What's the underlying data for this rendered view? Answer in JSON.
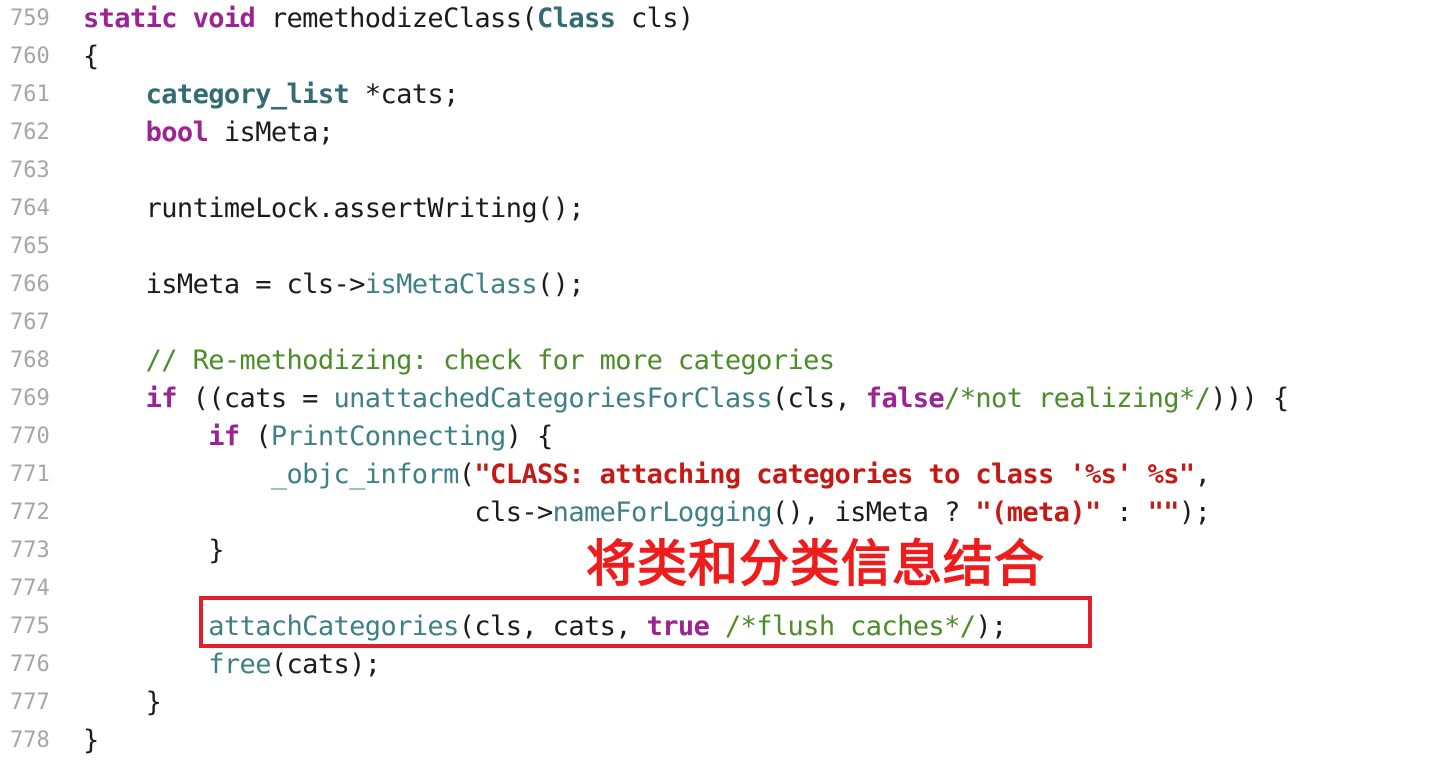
{
  "editor": {
    "lines": [
      {
        "num": "759",
        "tokens": [
          {
            "t": "static",
            "c": "kw"
          },
          {
            "t": " ",
            "c": "plain"
          },
          {
            "t": "void",
            "c": "kw"
          },
          {
            "t": " remethodizeClass(",
            "c": "plain"
          },
          {
            "t": "Class",
            "c": "type"
          },
          {
            "t": " cls)",
            "c": "plain"
          }
        ]
      },
      {
        "num": "760",
        "tokens": [
          {
            "t": "{",
            "c": "plain"
          }
        ]
      },
      {
        "num": "761",
        "tokens": [
          {
            "t": "    ",
            "c": "plain"
          },
          {
            "t": "category_list",
            "c": "type"
          },
          {
            "t": " *cats;",
            "c": "plain"
          }
        ]
      },
      {
        "num": "762",
        "tokens": [
          {
            "t": "    ",
            "c": "plain"
          },
          {
            "t": "bool",
            "c": "kw"
          },
          {
            "t": " isMeta;",
            "c": "plain"
          }
        ]
      },
      {
        "num": "763",
        "tokens": []
      },
      {
        "num": "764",
        "tokens": [
          {
            "t": "    runtimeLock.assertWriting();",
            "c": "plain"
          }
        ]
      },
      {
        "num": "765",
        "tokens": []
      },
      {
        "num": "766",
        "tokens": [
          {
            "t": "    isMeta = cls->",
            "c": "plain"
          },
          {
            "t": "isMetaClass",
            "c": "fn"
          },
          {
            "t": "();",
            "c": "plain"
          }
        ]
      },
      {
        "num": "767",
        "tokens": []
      },
      {
        "num": "768",
        "tokens": [
          {
            "t": "    ",
            "c": "plain"
          },
          {
            "t": "// Re-methodizing: check for more categories",
            "c": "cmt"
          }
        ]
      },
      {
        "num": "769",
        "tokens": [
          {
            "t": "    ",
            "c": "plain"
          },
          {
            "t": "if",
            "c": "kw"
          },
          {
            "t": " ((cats = ",
            "c": "plain"
          },
          {
            "t": "unattachedCategoriesForClass",
            "c": "fn"
          },
          {
            "t": "(cls, ",
            "c": "plain"
          },
          {
            "t": "false",
            "c": "kw"
          },
          {
            "t": "/*not realizing*/",
            "c": "cmt"
          },
          {
            "t": "))) {",
            "c": "plain"
          }
        ]
      },
      {
        "num": "770",
        "tokens": [
          {
            "t": "        ",
            "c": "plain"
          },
          {
            "t": "if",
            "c": "kw"
          },
          {
            "t": " (",
            "c": "plain"
          },
          {
            "t": "PrintConnecting",
            "c": "fn"
          },
          {
            "t": ") {",
            "c": "plain"
          }
        ]
      },
      {
        "num": "771",
        "tokens": [
          {
            "t": "            ",
            "c": "plain"
          },
          {
            "t": "_objc_inform",
            "c": "fn"
          },
          {
            "t": "(",
            "c": "plain"
          },
          {
            "t": "\"CLASS: attaching categories to class '%s' %s\"",
            "c": "str"
          },
          {
            "t": ",",
            "c": "plain"
          }
        ]
      },
      {
        "num": "772",
        "tokens": [
          {
            "t": "                         cls->",
            "c": "plain"
          },
          {
            "t": "nameForLogging",
            "c": "fn"
          },
          {
            "t": "(), isMeta ? ",
            "c": "plain"
          },
          {
            "t": "\"(meta)\"",
            "c": "str"
          },
          {
            "t": " : ",
            "c": "plain"
          },
          {
            "t": "\"\"",
            "c": "str"
          },
          {
            "t": ");",
            "c": "plain"
          }
        ]
      },
      {
        "num": "773",
        "tokens": [
          {
            "t": "        }",
            "c": "plain"
          }
        ]
      },
      {
        "num": "774",
        "tokens": []
      },
      {
        "num": "775",
        "tokens": [
          {
            "t": "        ",
            "c": "plain"
          },
          {
            "t": "attachCategories",
            "c": "fn"
          },
          {
            "t": "(cls, cats, ",
            "c": "plain"
          },
          {
            "t": "true",
            "c": "kw"
          },
          {
            "t": " ",
            "c": "plain"
          },
          {
            "t": "/*flush caches*/",
            "c": "cmt"
          },
          {
            "t": ");",
            "c": "plain"
          }
        ]
      },
      {
        "num": "776",
        "tokens": [
          {
            "t": "        ",
            "c": "plain"
          },
          {
            "t": "free",
            "c": "fn"
          },
          {
            "t": "(cats);",
            "c": "plain"
          }
        ]
      },
      {
        "num": "777",
        "tokens": [
          {
            "t": "    }",
            "c": "plain"
          }
        ]
      },
      {
        "num": "778",
        "tokens": [
          {
            "t": "}",
            "c": "plain"
          }
        ]
      }
    ]
  },
  "annotation": {
    "text": "将类和分类信息结合",
    "color": "#ee1c1c"
  },
  "highlight": {
    "line": "775",
    "border_color": "#e0202a"
  },
  "colors": {
    "keyword": "#9b2393",
    "type": "#326d74",
    "function": "#3e8087",
    "string": "#c41a16",
    "comment": "#4c8c29",
    "line_number": "#a6a6a6"
  }
}
